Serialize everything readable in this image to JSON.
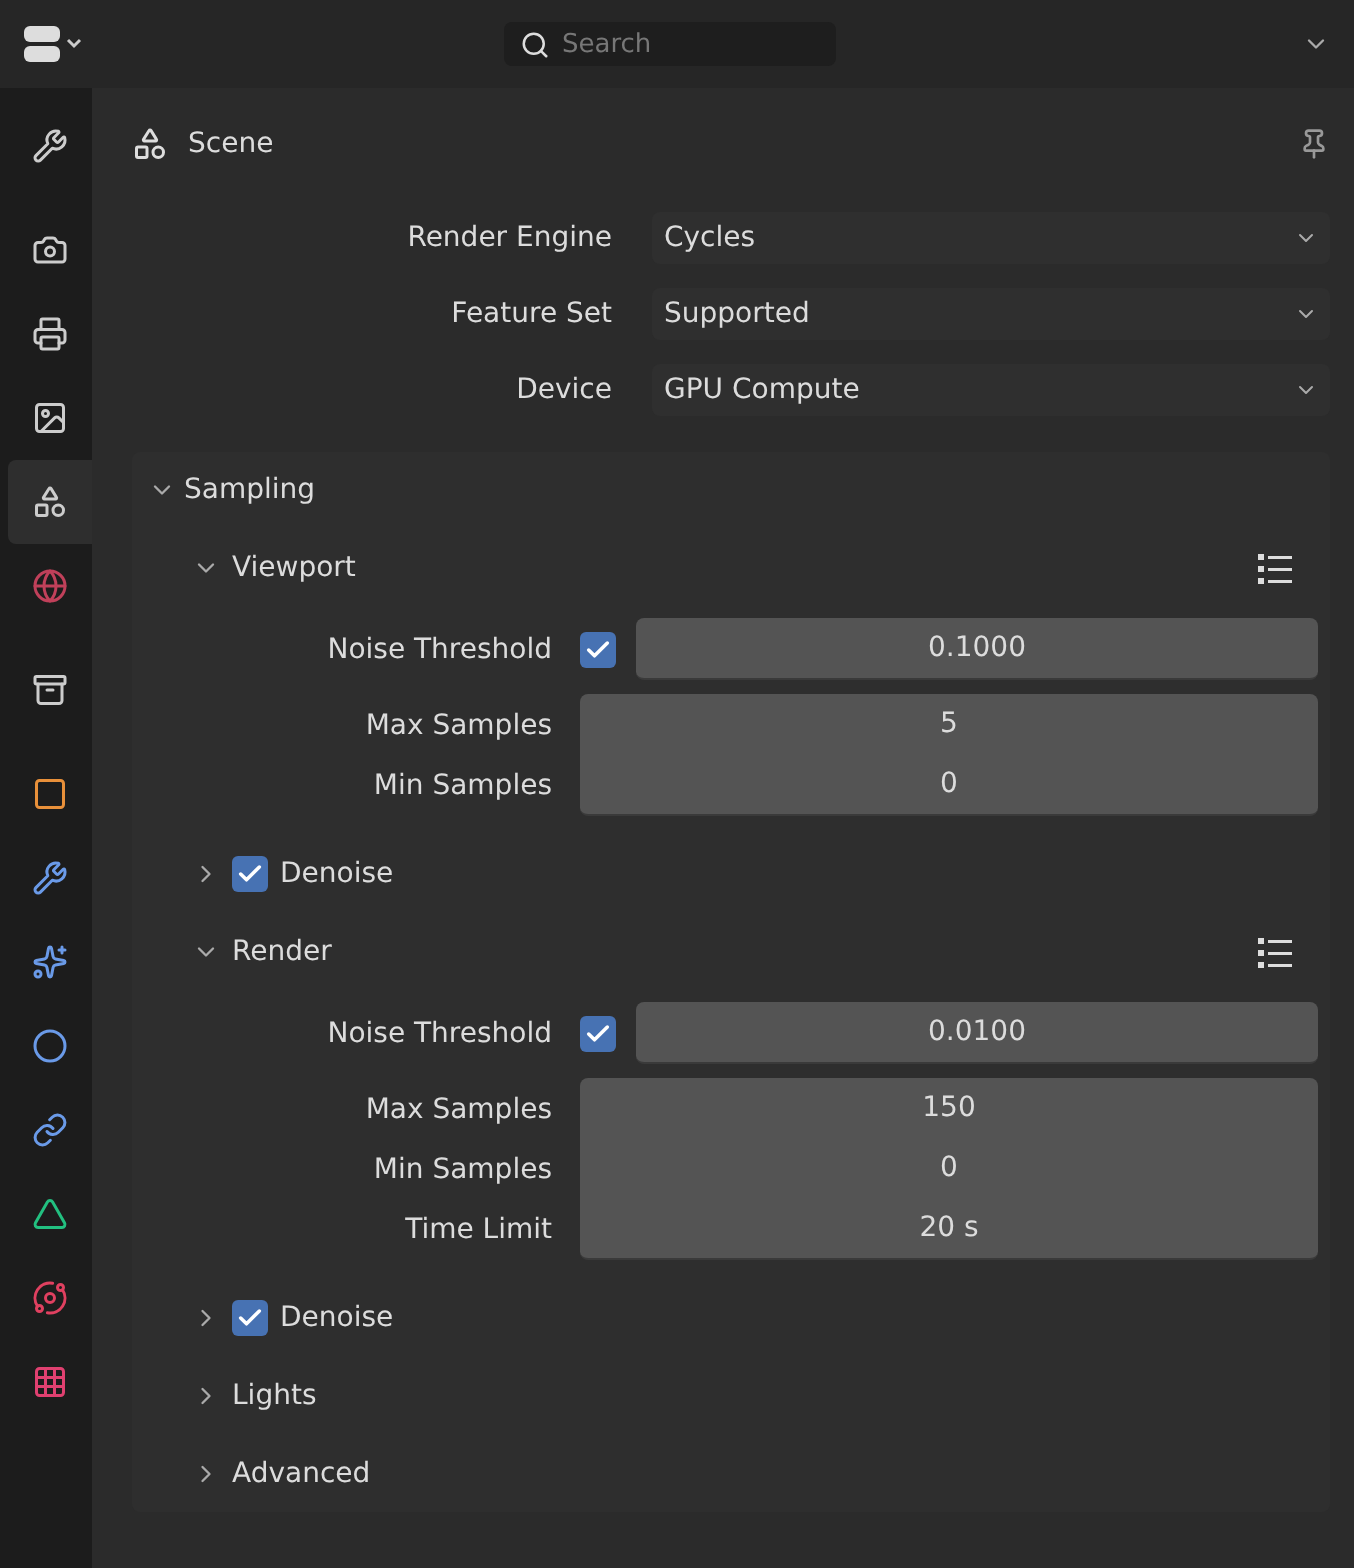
{
  "header": {
    "search": {
      "placeholder": "Search"
    }
  },
  "sidebar": {
    "groups": [
      [
        {
          "kind": "tool",
          "selected": false
        }
      ],
      [
        {
          "kind": "render",
          "selected": false
        },
        {
          "kind": "output",
          "selected": false
        },
        {
          "kind": "view_layer",
          "selected": false
        },
        {
          "kind": "scene",
          "selected": true
        },
        {
          "kind": "world",
          "selected": false
        }
      ],
      [
        {
          "kind": "collection",
          "selected": false
        }
      ],
      [
        {
          "kind": "object",
          "selected": false
        },
        {
          "kind": "modifiers",
          "selected": false
        },
        {
          "kind": "particles",
          "selected": false
        },
        {
          "kind": "physics",
          "selected": false
        },
        {
          "kind": "constraints",
          "selected": false
        },
        {
          "kind": "data",
          "selected": false
        },
        {
          "kind": "material",
          "selected": false
        },
        {
          "kind": "texture",
          "selected": false
        }
      ]
    ]
  },
  "context": {
    "title": "Scene"
  },
  "properties": [
    {
      "label": "Render Engine",
      "value": "Cycles"
    },
    {
      "label": "Feature Set",
      "value": "Supported"
    },
    {
      "label": "Device",
      "value": "GPU Compute"
    }
  ],
  "panels": [
    {
      "title": "Sampling",
      "expanded": true,
      "children": [
        {
          "title": "Viewport",
          "expanded": true,
          "presets": true,
          "groups": [
            [
              {
                "label": "Noise Threshold",
                "value": "0.1000",
                "checked": true
              }
            ],
            [
              {
                "label": "Max Samples",
                "value": "5"
              },
              {
                "label": "Min Samples",
                "value": "0"
              }
            ]
          ]
        },
        {
          "title": "Denoise",
          "expanded": false,
          "checked": true
        },
        {
          "title": "Render",
          "expanded": true,
          "presets": true,
          "groups": [
            [
              {
                "label": "Noise Threshold",
                "value": "0.0100",
                "checked": true
              }
            ],
            [
              {
                "label": "Max Samples",
                "value": "150"
              },
              {
                "label": "Min Samples",
                "value": "0"
              },
              {
                "label": "Time Limit",
                "value": "20 s"
              }
            ]
          ]
        },
        {
          "title": "Denoise",
          "expanded": false,
          "checked": true
        },
        {
          "title": "Lights",
          "expanded": false
        },
        {
          "title": "Advanced",
          "expanded": false
        }
      ]
    }
  ]
}
